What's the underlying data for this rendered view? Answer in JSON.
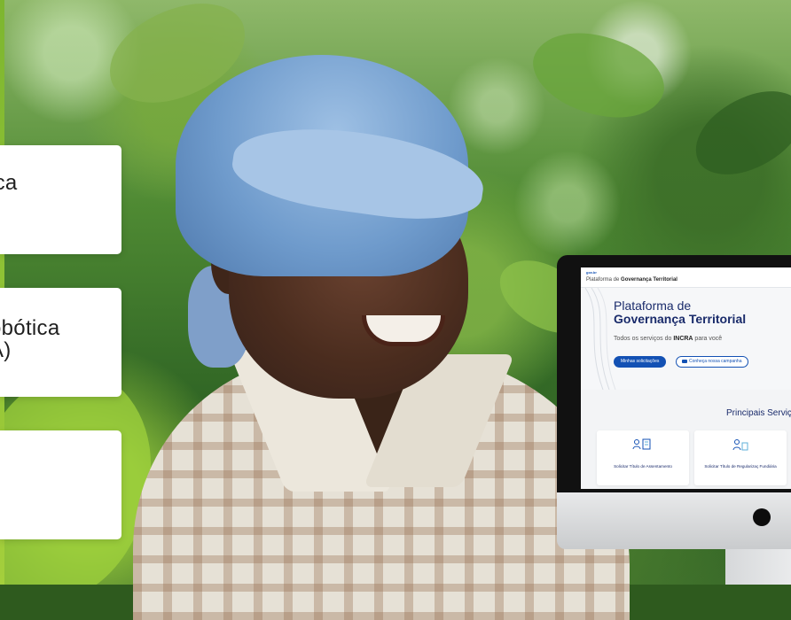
{
  "cards": [
    {
      "text": "ica"
    },
    {
      "text_line1": "obótica",
      "text_line2": "A)"
    },
    {
      "text": ""
    }
  ],
  "monitor": {
    "header": {
      "logo_text": "gov.br",
      "title_prefix": "Plataforma de ",
      "title_bold": "Governança Territorial"
    },
    "hero": {
      "title_line1": "Plataforma de",
      "title_line2": "Governança Territorial",
      "subtitle_prefix": "Todos os serviços do ",
      "subtitle_bold": "INCRA",
      "subtitle_suffix": " para você",
      "primary_button": "Minhas solicitações",
      "secondary_button": "Conheça nossa campanha"
    },
    "services": {
      "title": "Principais Serviço",
      "items": [
        {
          "label": "Solicitar Título de Assentamento",
          "icon": "people-document-icon"
        },
        {
          "label": "Solicitar Título de Regularizaç Fundiária",
          "icon": "land-document-icon"
        }
      ]
    }
  },
  "colors": {
    "accent_green": "#7db62f",
    "gov_blue": "#1351b4",
    "navy_text": "#1a2b6b"
  }
}
